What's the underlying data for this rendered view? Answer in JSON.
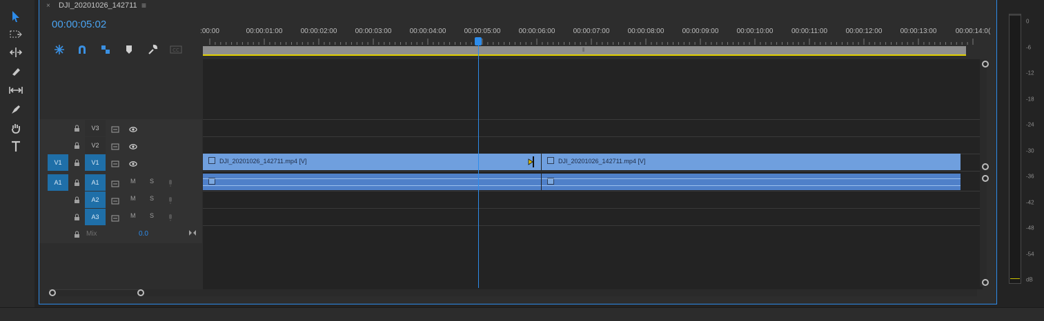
{
  "sequence": {
    "tab_close": "×",
    "tab_title": "DJI_20201026_142711",
    "tab_menu": "≡",
    "timecode": "00:00:05:02"
  },
  "ruler": {
    "labels": [
      ":00:00",
      "00:00:01:00",
      "00:00:02:00",
      "00:00:03:00",
      "00:00:04:00",
      "00:00:05:00",
      "00:00:06:00",
      "00:00:07:00",
      "00:00:08:00",
      "00:00:09:00",
      "00:00:10:00",
      "00:00:11:00",
      "00:00:12:00",
      "00:00:13:00",
      "00:00:14:0("
    ],
    "playhead_time": "00:00:05:02"
  },
  "tracks": {
    "video": [
      {
        "src": "",
        "dst": "V3"
      },
      {
        "src": "",
        "dst": "V2"
      },
      {
        "src": "V1",
        "dst": "V1"
      }
    ],
    "audio": [
      {
        "src": "A1",
        "dst": "A1",
        "m": "M",
        "s": "S"
      },
      {
        "src": "",
        "dst": "A2",
        "m": "M",
        "s": "S"
      },
      {
        "src": "",
        "dst": "A3",
        "m": "M",
        "s": "S"
      }
    ],
    "mix_label": "Mix",
    "mix_value": "0.0"
  },
  "clips": {
    "video": [
      {
        "label": "DJI_20201026_142711.mp4 [V]"
      },
      {
        "label": "DJI_20201026_142711.mp4 [V]"
      }
    ]
  },
  "meter": {
    "ticks": [
      "0",
      "-6",
      "-12",
      "-18",
      "-24",
      "-30",
      "-36",
      "-42",
      "-48",
      "-54",
      "dB"
    ]
  },
  "colors": {
    "accent": "#2d8ceb",
    "clip_video": "#6f9fde",
    "clip_audio": "#4f80c9",
    "workarea_line": "#e3d100",
    "track_tag_active": "#1f6fa8"
  },
  "icons": {
    "tools": [
      "selection-tool-icon",
      "track-select-forward-tool-icon",
      "ripple-edit-tool-icon",
      "razor-tool-icon",
      "slip-tool-icon",
      "pen-tool-icon",
      "hand-tool-icon",
      "type-tool-icon"
    ],
    "header": [
      "nest-sequence-icon",
      "snap-magnet-icon",
      "linked-selection-icon",
      "add-marker-icon",
      "timeline-settings-wrench-icon",
      "captions-cc-icon"
    ]
  }
}
